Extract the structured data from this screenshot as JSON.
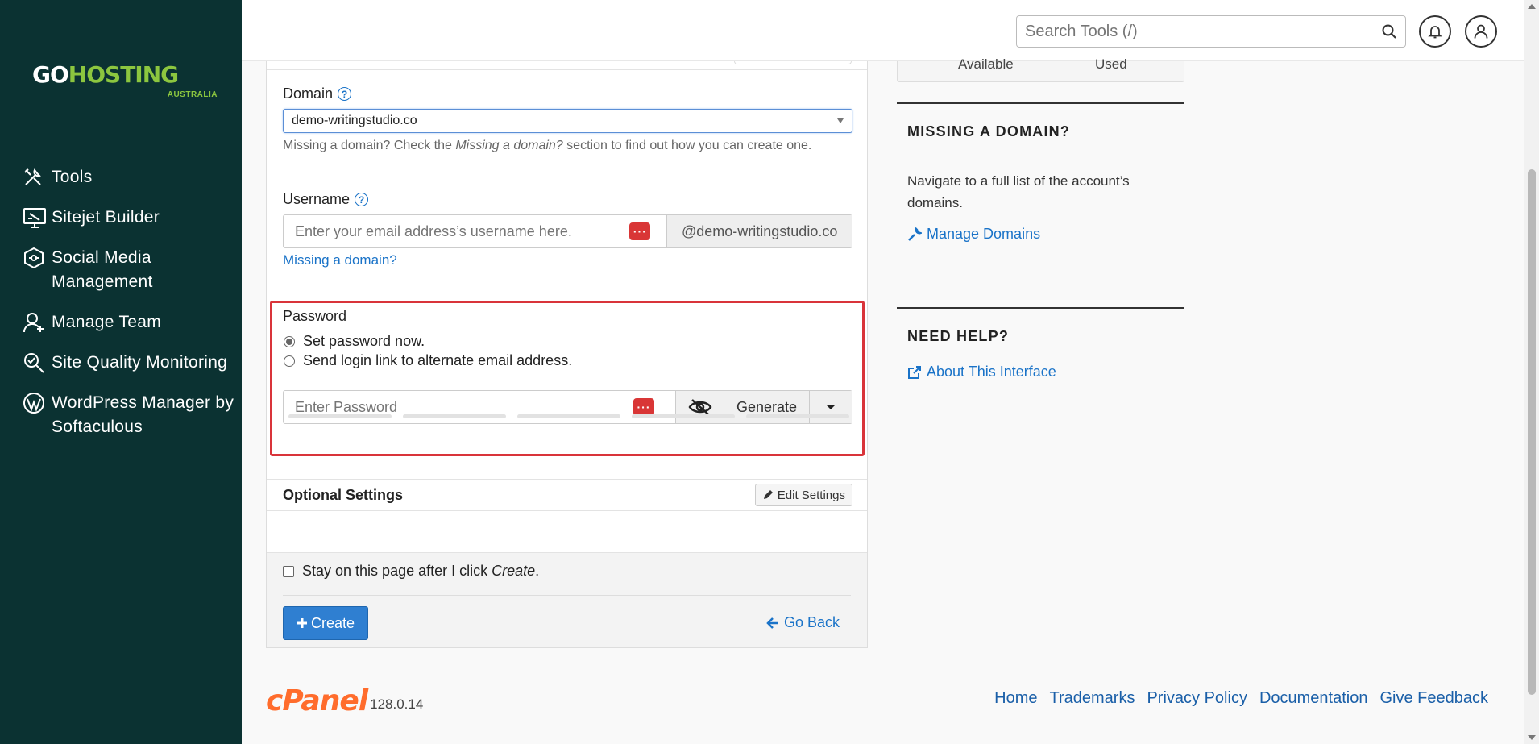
{
  "brand": {
    "logo_go": "GO",
    "logo_hosting": "HOSTING",
    "logo_sub": "AUSTRALIA"
  },
  "sidebar": {
    "items": [
      {
        "label": "Tools",
        "icon": "tools-icon"
      },
      {
        "label": "Sitejet Builder",
        "icon": "monitor-builder-icon"
      },
      {
        "label": "Social Media Management",
        "icon": "social-media-icon"
      },
      {
        "label": "Manage Team",
        "icon": "user-plus-icon"
      },
      {
        "label": "Site Quality Monitoring",
        "icon": "magnifier-check-icon"
      },
      {
        "label": "WordPress Manager by Softaculous",
        "icon": "wordpress-icon"
      }
    ]
  },
  "header": {
    "search_placeholder": "Search Tools (/)"
  },
  "form": {
    "domain_label": "Domain",
    "domain_value": "demo-writingstudio.co",
    "domain_hint_pre": "Missing a domain? Check the ",
    "domain_hint_em": "Missing a domain?",
    "domain_hint_post": " section to find out how you can create one.",
    "username_label": "Username",
    "username_placeholder": "Enter your email address’s username here.",
    "username_suffix": "@demo-writingstudio.co",
    "missing_domain_link": "Missing a domain?",
    "password_label": "Password",
    "radio_set_now": "Set password now.",
    "radio_send_link": "Send login link to alternate email address.",
    "password_placeholder": "Enter Password",
    "generate_label": "Generate",
    "optional_title": "Optional Settings",
    "edit_settings_label": "Edit Settings",
    "stay_pre": "Stay on this page after I click ",
    "stay_em": "Create",
    "stay_post": ".",
    "create_label": "Create",
    "go_back_label": "Go Back"
  },
  "right": {
    "stub_left": "Available",
    "stub_right": "Used",
    "missing_title": "MISSING A DOMAIN?",
    "missing_text": "Navigate to a full list of the account’s domains.",
    "manage_domains": "Manage Domains",
    "help_title": "NEED HELP?",
    "about": "About This Interface"
  },
  "footer": {
    "brand": "cPanel",
    "version": "128.0.14",
    "links": [
      "Home",
      "Trademarks",
      "Privacy Policy",
      "Documentation",
      "Give Feedback"
    ]
  },
  "colors": {
    "sidebar_bg": "#0b3232",
    "brand_green": "#8cc63f",
    "accent_blue": "#2f7fd1",
    "highlight_red": "#d9343a",
    "cpanel_orange": "#ff6c2c"
  }
}
